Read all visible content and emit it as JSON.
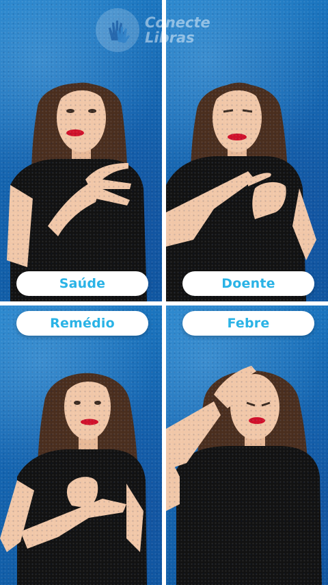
{
  "watermark": {
    "brand_line1": "Conecte",
    "brand_line2": "Libras",
    "icon": "hands-logo-icon"
  },
  "panels": [
    {
      "label": "Saúde",
      "pill_position": "bottom"
    },
    {
      "label": "Doente",
      "pill_position": "bottom"
    },
    {
      "label": "Remédio",
      "pill_position": "top"
    },
    {
      "label": "Febre",
      "pill_position": "top"
    }
  ],
  "colors": {
    "background_blue": "#1565b0",
    "label_text": "#2ab3e6",
    "shirt": "#121212",
    "hair": "#4a2e1e",
    "skin": "#f1c7a8",
    "lips": "#d0102a"
  }
}
